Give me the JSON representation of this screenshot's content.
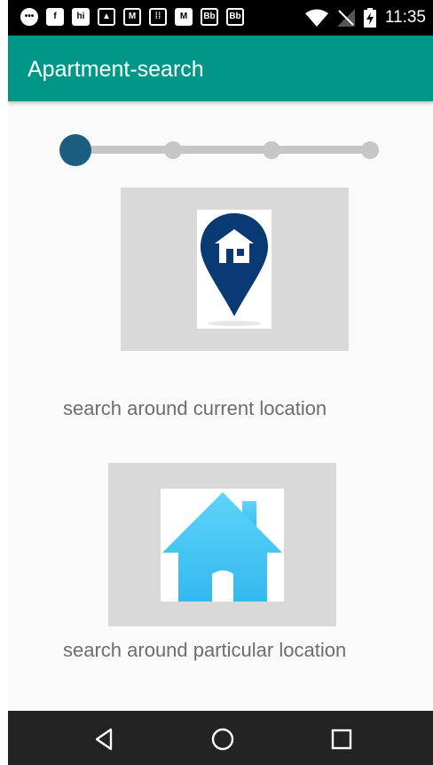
{
  "status_bar": {
    "time": "11:35",
    "left_icons": [
      "chat-icon",
      "facebook-icon",
      "hi-icon",
      "image-icon",
      "gmail-icon",
      "keypad-icon",
      "gmail-icon",
      "bb-icon",
      "bb-icon"
    ],
    "right_icons": [
      "wifi-icon",
      "no-signal-icon",
      "battery-charging-icon"
    ]
  },
  "app_bar": {
    "title": "Apartment-search",
    "color": "#009688"
  },
  "stepper": {
    "total_steps": 4,
    "current_step": 1,
    "active_color": "#1b5e80",
    "inactive_color": "#c6c6c6"
  },
  "options": [
    {
      "label": "search around current location",
      "icon": "map-pin-house-icon"
    },
    {
      "label": "search around particular location",
      "icon": "house-icon"
    }
  ],
  "nav_bar": {
    "buttons": [
      "back-icon",
      "home-icon",
      "recent-apps-icon"
    ]
  }
}
